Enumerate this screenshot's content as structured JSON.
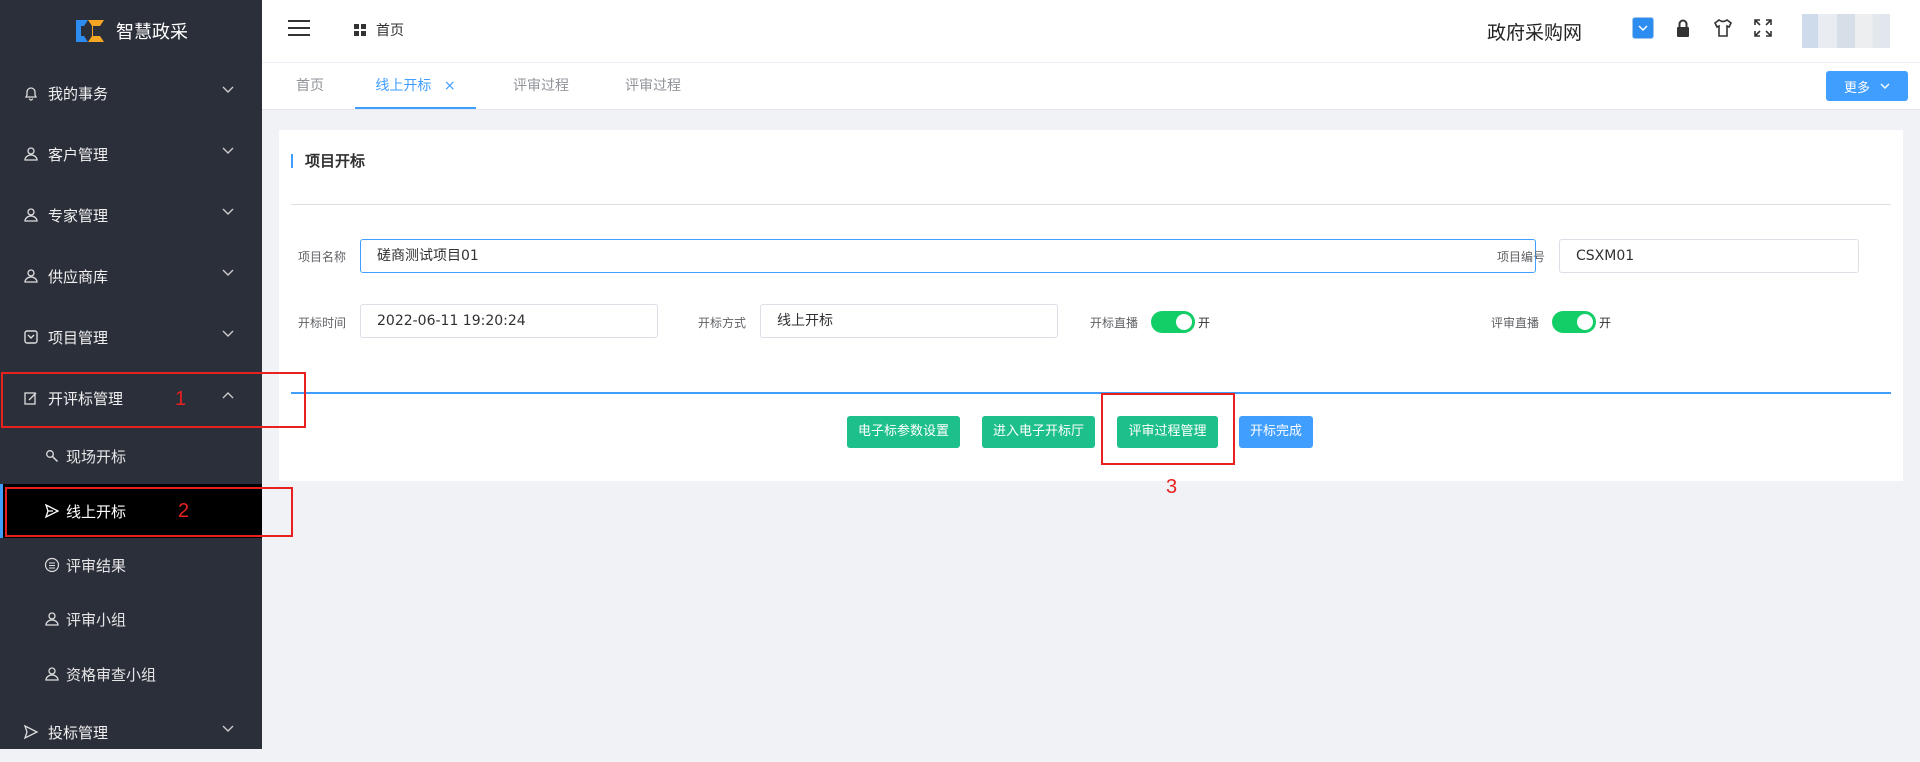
{
  "app": {
    "name": "智慧政采",
    "site_title": "政府采购网"
  },
  "header": {
    "breadcrumb": "首页"
  },
  "sidebar": {
    "menus": [
      {
        "label": "我的事务"
      },
      {
        "label": "客户管理"
      },
      {
        "label": "专家管理"
      },
      {
        "label": "供应商库"
      },
      {
        "label": "项目管理"
      },
      {
        "label": "开评标管理"
      },
      {
        "label": "投标管理"
      }
    ],
    "sub_items": [
      {
        "label": "现场开标"
      },
      {
        "label": "线上开标"
      },
      {
        "label": "评审结果"
      },
      {
        "label": "评审小组"
      },
      {
        "label": "资格审查小组"
      }
    ]
  },
  "tabs": [
    {
      "label": "首页"
    },
    {
      "label": "线上开标",
      "close": "×"
    },
    {
      "label": "评审过程"
    },
    {
      "label": "评审过程"
    }
  ],
  "more_button": "更多",
  "panel": {
    "title": "项目开标",
    "fields": {
      "project_name_label": "项目名称",
      "project_name_value": "磋商测试项目01",
      "project_code_label": "项目编号",
      "project_code_value": "CSXM01",
      "open_time_label": "开标时间",
      "open_time_value": "2022-06-11 19:20:24",
      "open_method_label": "开标方式",
      "open_method_value": "线上开标",
      "open_live_label": "开标直播",
      "open_live_state": "开",
      "review_live_label": "评审直播",
      "review_live_state": "开"
    },
    "buttons": {
      "param_settings": "电子标参数设置",
      "enter_hall": "进入电子开标厅",
      "review_process": "评审过程管理",
      "finish": "开标完成"
    }
  },
  "annotations": {
    "n1": "1",
    "n2": "2",
    "n3": "3"
  },
  "colors": {
    "sidebar_bg": "#2b2f3a",
    "accent": "#409eff",
    "green_button": "#1dbf8a",
    "switch_on": "#13ce66",
    "annotation": "#e82020"
  }
}
